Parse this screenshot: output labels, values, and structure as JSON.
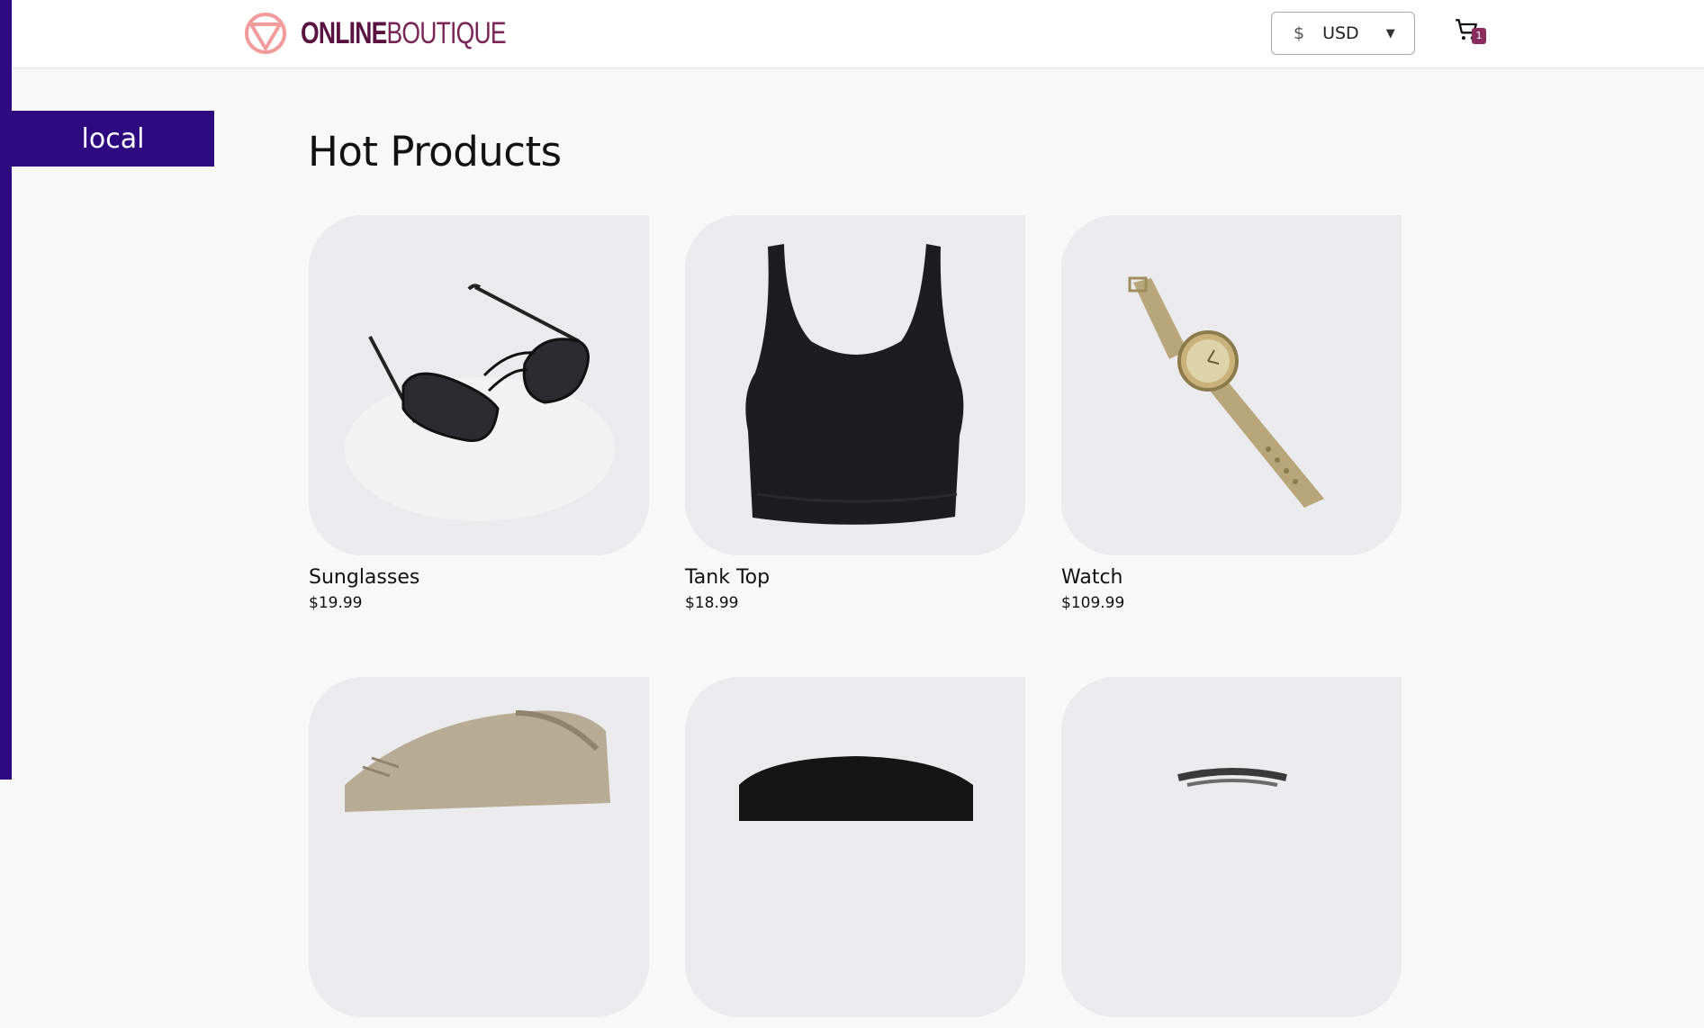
{
  "brand": {
    "name_bold": "ONLINE",
    "name_light": "BOUTIQUE",
    "mark_color": "#f29b9b"
  },
  "currency": {
    "symbol": "$",
    "code": "USD"
  },
  "cart": {
    "count": "1"
  },
  "env_banner": {
    "label": "local"
  },
  "section": {
    "title": "Hot Products"
  },
  "products": [
    {
      "name": "Sunglasses",
      "price": "$19.99"
    },
    {
      "name": "Tank Top",
      "price": "$18.99"
    },
    {
      "name": "Watch",
      "price": "$109.99"
    },
    {
      "name": "",
      "price": ""
    },
    {
      "name": "",
      "price": ""
    },
    {
      "name": "",
      "price": ""
    }
  ],
  "colors": {
    "accent": "#2d0a7f",
    "badge": "#8b2c5f",
    "brand": "#5a1240"
  }
}
